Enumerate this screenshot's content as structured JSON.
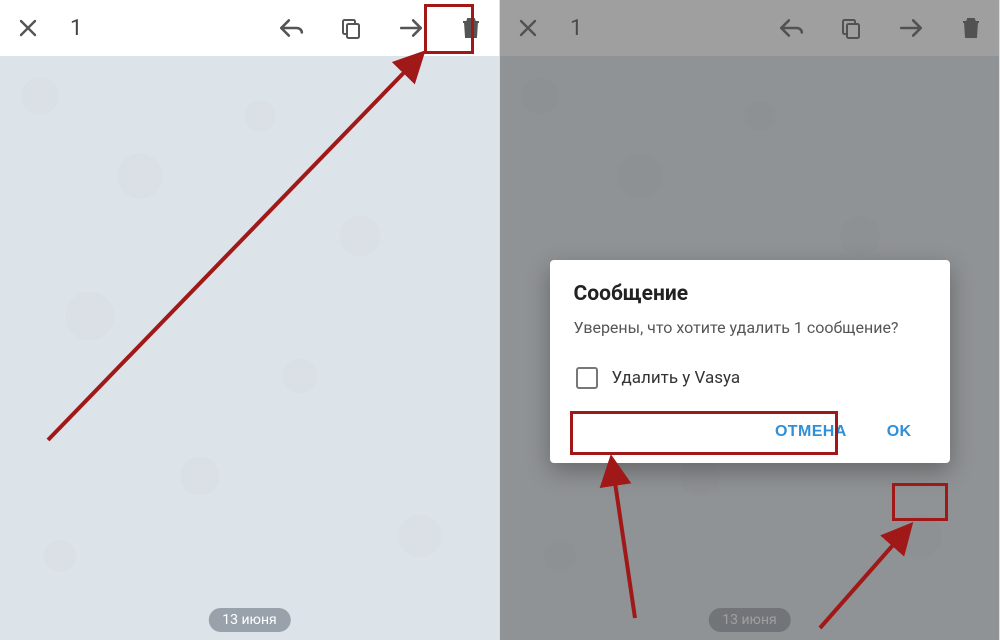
{
  "toolbar": {
    "selected_count": "1"
  },
  "date_chip": "13 июня",
  "dialog": {
    "title": "Сообщение",
    "body": "Уверены, что хотите удалить 1 сообщение?",
    "checkbox_label": "Удалить у Vasya",
    "cancel": "ОТМЕНА",
    "ok": "OK"
  },
  "annotation_color": "#a01818"
}
